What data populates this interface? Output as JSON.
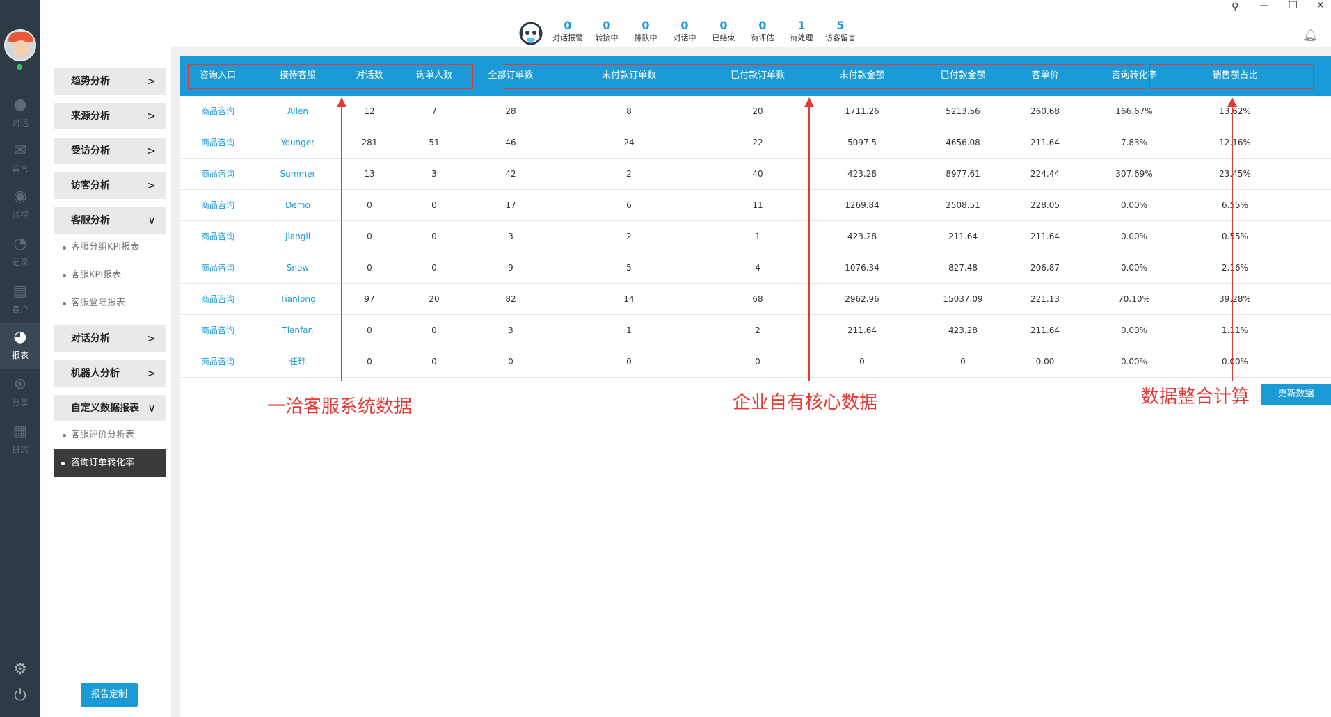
{
  "rail": {
    "items": [
      {
        "icon": "chat-bubble-icon",
        "label": "对话"
      },
      {
        "icon": "mail-icon",
        "label": "留言"
      },
      {
        "icon": "eye-icon",
        "label": "监控"
      },
      {
        "icon": "clock-icon",
        "label": "记录"
      },
      {
        "icon": "contact-card-icon",
        "label": "客户"
      },
      {
        "icon": "pie-chart-icon",
        "label": "报表"
      },
      {
        "icon": "share-icon",
        "label": "分享"
      },
      {
        "icon": "clipboard-icon",
        "label": "日志"
      }
    ],
    "active_index": 5
  },
  "menu": {
    "categories": [
      {
        "label": "趋势分析"
      },
      {
        "label": "来源分析"
      },
      {
        "label": "受访分析"
      },
      {
        "label": "访客分析"
      },
      {
        "label": "客服分析"
      },
      {
        "label": "对话分析"
      },
      {
        "label": "机器人分析"
      },
      {
        "label": "自定义数据报表"
      }
    ],
    "sub_kefu": [
      "客服分组KPI报表",
      "客服KPI报表",
      "客服登陆报表"
    ],
    "sub_custom": [
      "客服评价分析表",
      "咨询订单转化率"
    ],
    "report_button": "报告定制"
  },
  "topbar": {
    "stats": [
      {
        "num": "0",
        "label": "对话报警"
      },
      {
        "num": "0",
        "label": "转接中"
      },
      {
        "num": "0",
        "label": "排队中"
      },
      {
        "num": "0",
        "label": "对话中"
      },
      {
        "num": "0",
        "label": "已结束"
      },
      {
        "num": "0",
        "label": "待评估"
      },
      {
        "num": "1",
        "label": "待处理"
      },
      {
        "num": "5",
        "label": "访客留言"
      }
    ]
  },
  "table": {
    "headers": [
      "咨询入口",
      "接待客服",
      "对话数",
      "询单人数",
      "全部订单数",
      "未付款订单数",
      "已付款订单数",
      "未付款金额",
      "已付款金额",
      "客单价",
      "咨询转化率",
      "销售额占比"
    ],
    "rows": [
      [
        "商品咨询",
        "Allen",
        "12",
        "7",
        "28",
        "8",
        "20",
        "1711.26",
        "5213.56",
        "260.68",
        "166.67%",
        "13.62%"
      ],
      [
        "商品咨询",
        "Younger",
        "281",
        "51",
        "46",
        "24",
        "22",
        "5097.5",
        "4656.08",
        "211.64",
        "7.83%",
        "12.16%"
      ],
      [
        "商品咨询",
        "Summer",
        "13",
        "3",
        "42",
        "2",
        "40",
        "423.28",
        "8977.61",
        "224.44",
        "307.69%",
        "23.45%"
      ],
      [
        "商品咨询",
        "Demo",
        "0",
        "0",
        "17",
        "6",
        "11",
        "1269.84",
        "2508.51",
        "228.05",
        "0.00%",
        "6.55%"
      ],
      [
        "商品咨询",
        "Jiangli",
        "0",
        "0",
        "3",
        "2",
        "1",
        "423.28",
        "211.64",
        "211.64",
        "0.00%",
        "0.55%"
      ],
      [
        "商品咨询",
        "Snow",
        "0",
        "0",
        "9",
        "5",
        "4",
        "1076.34",
        "827.48",
        "206.87",
        "0.00%",
        "2.16%"
      ],
      [
        "商品咨询",
        "Tianlong",
        "97",
        "20",
        "82",
        "14",
        "68",
        "2962.96",
        "15037.09",
        "221.13",
        "70.10%",
        "39.28%"
      ],
      [
        "商品咨询",
        "Tianfan",
        "0",
        "0",
        "3",
        "1",
        "2",
        "211.64",
        "423.28",
        "211.64",
        "0.00%",
        "1.11%"
      ],
      [
        "商品咨询",
        "任玮",
        "0",
        "0",
        "0",
        "0",
        "0",
        "0",
        "0",
        "0.00",
        "0.00%",
        "0.00%"
      ]
    ],
    "update_button": "更新数据"
  },
  "annotations": [
    "一洽客服系统数据",
    "企业自有核心数据",
    "数据整合计算"
  ],
  "colors": {
    "accent": "#1b9ad8",
    "annotation": "#e53935",
    "rail": "#2f3a47"
  }
}
